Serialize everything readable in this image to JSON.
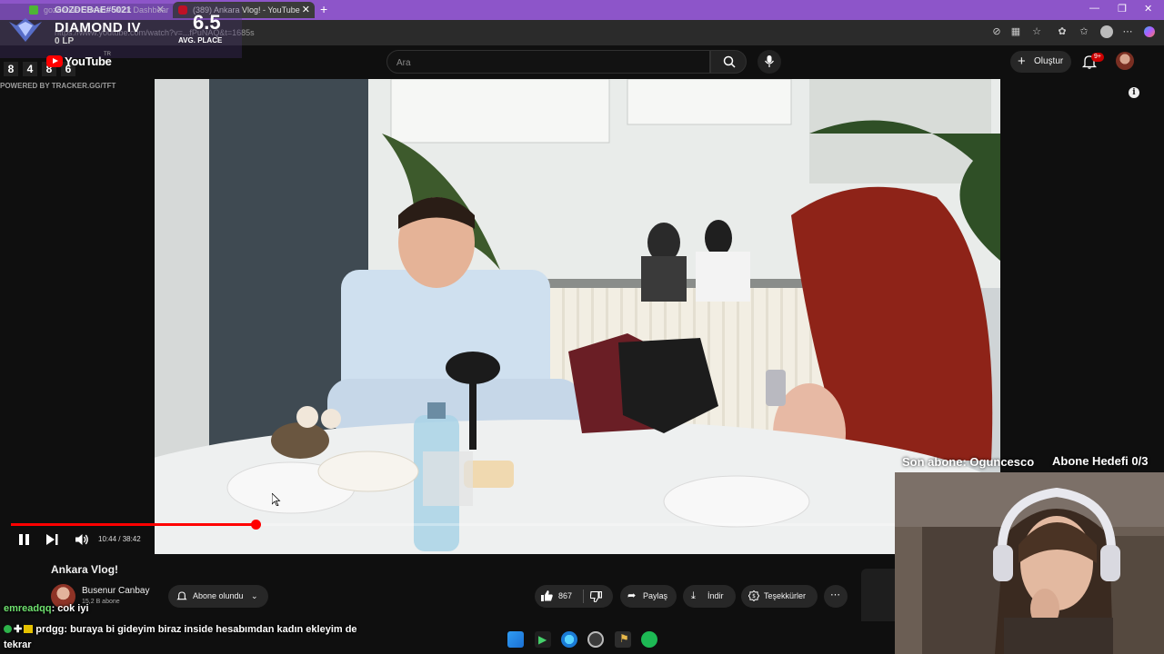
{
  "browser": {
    "tabs": [
      {
        "title": "gozdebae Stream - Kick Dashboard",
        "active": false
      },
      {
        "title": "(389) Ankara Vlog! - YouTube",
        "active": true
      }
    ],
    "url": "https://www.youtube.com/watch?v=...fPuNAQ&t=1685s"
  },
  "game_overlay": {
    "summoner": "GOZDEBAE#5021",
    "rank": "DIAMOND IV",
    "lp": "0 LP",
    "avg_place": "6.5",
    "avg_place_label": "AVG. PLACE",
    "recent_placements": [
      "8",
      "4",
      "8",
      "6"
    ],
    "powered_by": "POWERED BY TRACKER.GG/TFT"
  },
  "youtube": {
    "logo_text": "YouTube",
    "region": "TR",
    "search_placeholder": "Ara",
    "create_label": "Oluştur",
    "notification_badge": "9+",
    "icons": [
      "menu-icon",
      "search-icon",
      "mic-icon",
      "bell-icon",
      "info-icon"
    ]
  },
  "player": {
    "current_time": "10:44",
    "duration": "38:42",
    "time_display": "10:44 / 38:42",
    "progress_fraction": 0.277
  },
  "video": {
    "title": "Ankara Vlog!",
    "channel": "Busenur Canbay",
    "subscribers": "15,2 B abone",
    "subscribe_state": "Abone olundu",
    "likes": "867",
    "share": "Paylaş",
    "download": "İndir",
    "thanks": "Teşekkürler"
  },
  "stream_overlay": {
    "last_sub": "Son abone: Oguncesco",
    "sub_goal": "Abone Hedefi 0/3"
  },
  "chat": [
    {
      "user": "emreadqq",
      "text": ": cok iyi"
    },
    {
      "user": "prdgg",
      "text": ": buraya bi gideyim biraz inside hesabımdan kadın ekleyim de tekrar"
    }
  ],
  "colors": {
    "tab_bar": "#8d55c9",
    "progress": "#ff0000",
    "chat_user": "#6fe26f"
  }
}
